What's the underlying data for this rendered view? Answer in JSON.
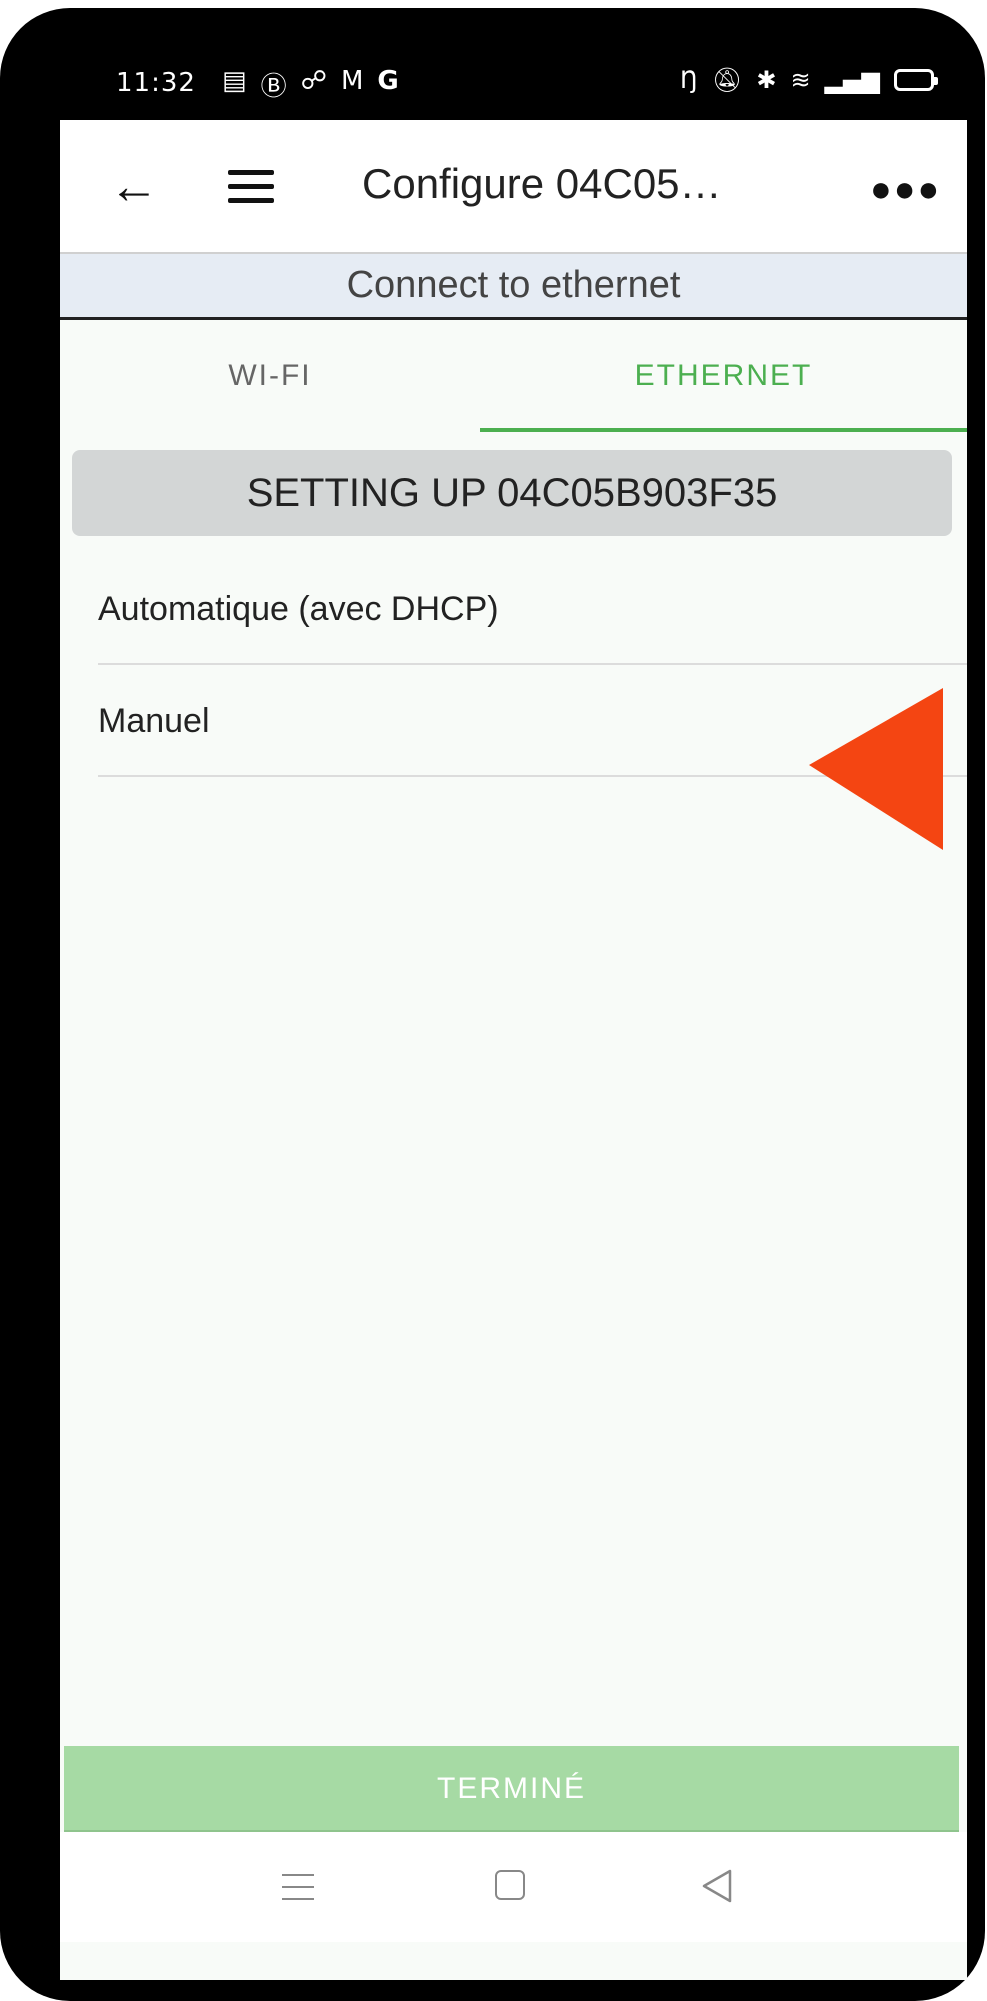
{
  "status_bar": {
    "time": "11:32",
    "left_icons": [
      "news-icon",
      "b-circle-icon",
      "missed-call-icon",
      "gmail-icon",
      "google-icon"
    ],
    "right_icons": [
      "nfc-icon",
      "mute-icon",
      "bluetooth-icon",
      "wifi-icon",
      "signal-icon",
      "battery-icon"
    ]
  },
  "appbar": {
    "title": "Configure 04C05…"
  },
  "subtitle": "Connect to ethernet",
  "tabs": [
    {
      "label": "WI-FI",
      "selected": false
    },
    {
      "label": "ETHERNET",
      "selected": true
    }
  ],
  "setup_banner": "SETTING UP 04C05B903F35",
  "options": [
    {
      "label": "Automatique (avec DHCP)"
    },
    {
      "label": "Manuel"
    }
  ],
  "done_button": "TERMINÉ",
  "colors": {
    "accent": "#4caf50",
    "done_bg": "#a6daa4",
    "annotation_arrow": "#f44512"
  }
}
